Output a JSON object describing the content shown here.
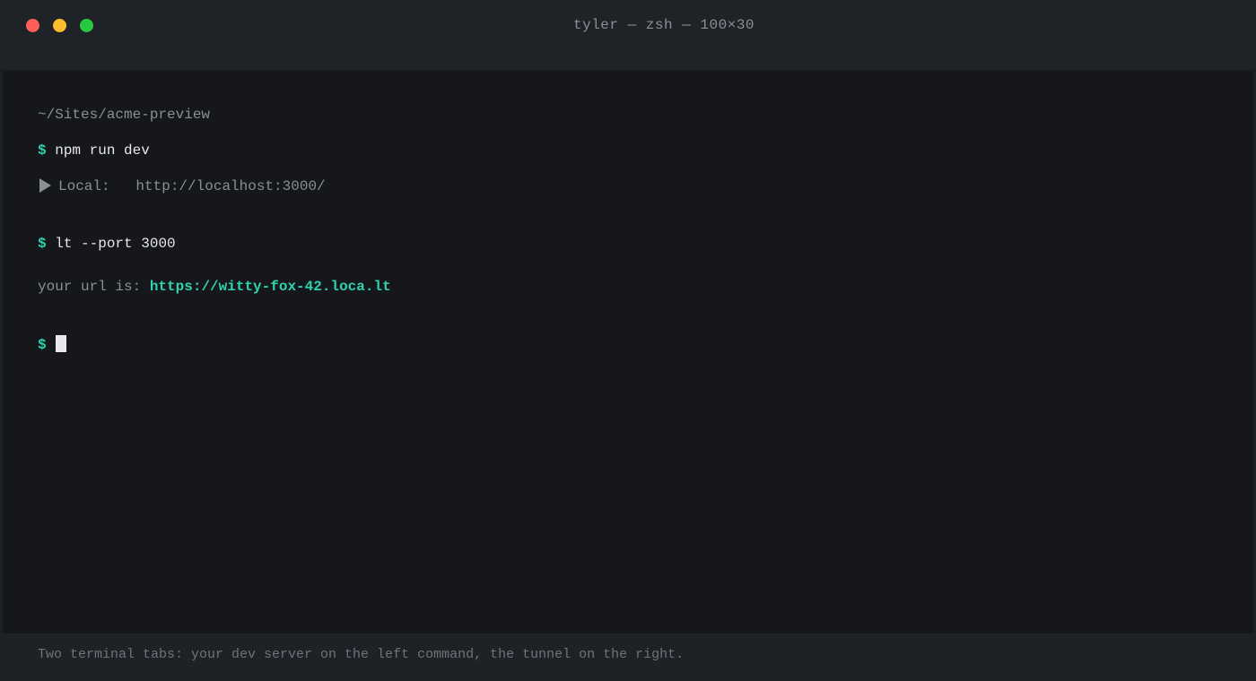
{
  "window": {
    "title": "tyler — zsh — 100×30"
  },
  "terminal": {
    "cwd": "~/Sites/acme-preview",
    "prompt": "$",
    "cmd1": "npm run dev",
    "local_label": "Local:",
    "local_url": "http://localhost:3000/",
    "cmd2": "lt --port 3000",
    "url_prefix": "your url is:",
    "tunnel_url": "https://witty-fox-42.loca.lt"
  },
  "caption": "Two terminal tabs: your dev server on the left command, the tunnel on the right.",
  "colors": {
    "accent": "#2ed3b0",
    "background": "#15171b",
    "titlebar": "#1f2226",
    "close": "#ff5f57",
    "minimize": "#febc2e",
    "maximize": "#28c840"
  }
}
